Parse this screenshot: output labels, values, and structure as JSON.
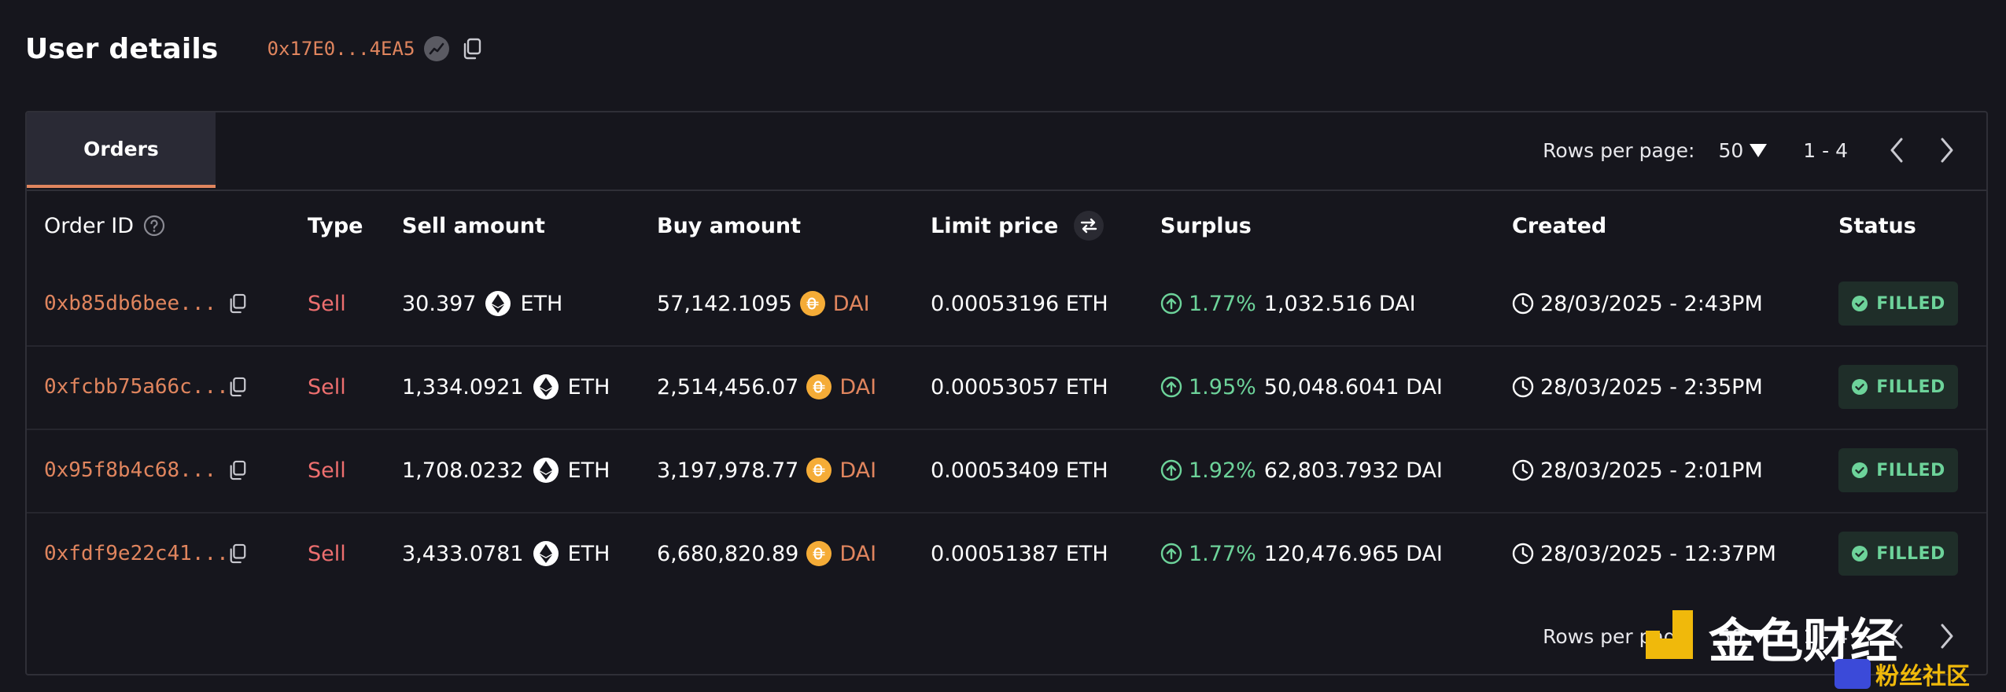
{
  "header": {
    "title": "User details",
    "address": "0x17E0...4EA5"
  },
  "tabs": [
    {
      "label": "Orders",
      "active": true
    }
  ],
  "pagination": {
    "rows_per_page_label": "Rows per page:",
    "rows_per_page_value": "50",
    "range": "1 - 4"
  },
  "columns": {
    "order_id": "Order ID",
    "type": "Type",
    "sell_amount": "Sell amount",
    "buy_amount": "Buy amount",
    "limit_price": "Limit price",
    "surplus": "Surplus",
    "created": "Created",
    "status": "Status"
  },
  "orders": [
    {
      "id": "0xb85db6bee...",
      "type": "Sell",
      "sell_amount": "30.397",
      "sell_token": "ETH",
      "buy_amount": "57,142.1095",
      "buy_token": "DAI",
      "limit_price": "0.00053196 ETH",
      "surplus_pct": "1.77%",
      "surplus_amount": "1,032.516 DAI",
      "created": "28/03/2025 - 2:43PM",
      "status": "FILLED"
    },
    {
      "id": "0xfcbb75a66c...",
      "type": "Sell",
      "sell_amount": "1,334.0921",
      "sell_token": "ETH",
      "buy_amount": "2,514,456.07",
      "buy_token": "DAI",
      "limit_price": "0.00053057 ETH",
      "surplus_pct": "1.95%",
      "surplus_amount": "50,048.6041 DAI",
      "created": "28/03/2025 - 2:35PM",
      "status": "FILLED"
    },
    {
      "id": "0x95f8b4c68...",
      "type": "Sell",
      "sell_amount": "1,708.0232",
      "sell_token": "ETH",
      "buy_amount": "3,197,978.77",
      "buy_token": "DAI",
      "limit_price": "0.00053409 ETH",
      "surplus_pct": "1.92%",
      "surplus_amount": "62,803.7932 DAI",
      "created": "28/03/2025 - 2:01PM",
      "status": "FILLED"
    },
    {
      "id": "0xfdf9e22c41...",
      "type": "Sell",
      "sell_amount": "3,433.0781",
      "sell_token": "ETH",
      "buy_amount": "6,680,820.89",
      "buy_token": "DAI",
      "limit_price": "0.00051387 ETH",
      "surplus_pct": "1.77%",
      "surplus_amount": "120,476.965 DAI",
      "created": "28/03/2025 - 12:37PM",
      "status": "FILLED"
    }
  ],
  "colors": {
    "background": "#16161d",
    "accent": "#e0855e",
    "sell": "#ee6f6f",
    "success": "#6dd39a",
    "badge_bg": "#1f2e29",
    "border": "#2f2f37"
  },
  "icons": {
    "address_badge": "analytics-icon",
    "copy": "copy-icon",
    "help": "question-circle-icon",
    "swap": "swap-arrows-icon",
    "eth": "eth-token-icon",
    "dai": "dai-token-icon",
    "surplus": "arrow-up-circle-icon",
    "created": "clock-icon",
    "status": "check-circle-icon",
    "prev": "chevron-left-icon",
    "next": "chevron-right-icon"
  },
  "watermark": {
    "brand_text": "金色财经",
    "sub_text": "粉丝社区"
  }
}
